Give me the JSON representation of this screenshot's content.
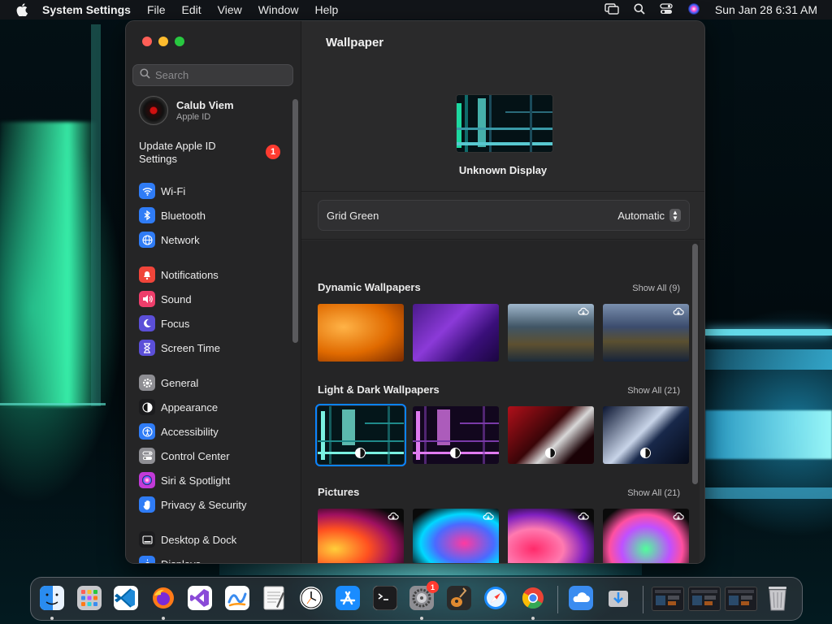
{
  "menubar": {
    "app_name": "System Settings",
    "items": [
      "File",
      "Edit",
      "View",
      "Window",
      "Help"
    ],
    "clock": "Sun Jan 28  6:31 AM"
  },
  "sidebar": {
    "search_placeholder": "Search",
    "account": {
      "name": "Calub Viem",
      "subtitle": "Apple ID"
    },
    "update": {
      "label": "Update Apple ID Settings",
      "badge": "1"
    },
    "groups": [
      [
        {
          "label": "Wi-Fi",
          "icon": "wifi-icon",
          "color": "#2f7cf6"
        },
        {
          "label": "Bluetooth",
          "icon": "bluetooth-icon",
          "color": "#2f7cf6"
        },
        {
          "label": "Network",
          "icon": "globe-icon",
          "color": "#2f7cf6"
        }
      ],
      [
        {
          "label": "Notifications",
          "icon": "bell-icon",
          "color": "#f0453a"
        },
        {
          "label": "Sound",
          "icon": "speaker-icon",
          "color": "#ee3e6b"
        },
        {
          "label": "Focus",
          "icon": "moon-icon",
          "color": "#5b4fd8"
        },
        {
          "label": "Screen Time",
          "icon": "hourglass-icon",
          "color": "#5b4fd8"
        }
      ],
      [
        {
          "label": "General",
          "icon": "gear-icon",
          "color": "#8e8e93"
        },
        {
          "label": "Appearance",
          "icon": "appearance-icon",
          "color": "#1c1c1e"
        },
        {
          "label": "Accessibility",
          "icon": "accessibility-icon",
          "color": "#2f7cf6"
        },
        {
          "label": "Control Center",
          "icon": "control-center-icon",
          "color": "#8e8e93"
        },
        {
          "label": "Siri & Spotlight",
          "icon": "siri-icon",
          "color": "#c23ad8"
        },
        {
          "label": "Privacy & Security",
          "icon": "hand-icon",
          "color": "#2f7cf6"
        }
      ],
      [
        {
          "label": "Desktop & Dock",
          "icon": "dock-icon",
          "color": "#1c1c1e"
        },
        {
          "label": "Displays",
          "icon": "sun-icon",
          "color": "#2f7cf6"
        }
      ]
    ]
  },
  "main": {
    "title": "Wallpaper",
    "display_name": "Unknown Display",
    "current_wallpaper": "Grid Green",
    "mode": "Automatic",
    "sections": [
      {
        "title": "Dynamic Wallpapers",
        "show_all": "Show All (9)",
        "thumbs": [
          {
            "style": "w-ventura",
            "cloud": false,
            "half": false
          },
          {
            "style": "w-monterey",
            "cloud": false,
            "half": false
          },
          {
            "style": "w-catalina-day",
            "cloud": true,
            "half": false
          },
          {
            "style": "w-catalina-dusk",
            "cloud": true,
            "half": false
          }
        ]
      },
      {
        "title": "Light & Dark Wallpapers",
        "show_all": "Show All (21)",
        "thumbs": [
          {
            "style": "w-grid-green",
            "cloud": false,
            "half": true,
            "selected": true
          },
          {
            "style": "w-grid-purple",
            "cloud": false,
            "half": true
          },
          {
            "style": "w-red-wave",
            "cloud": false,
            "half": true
          },
          {
            "style": "w-blue-wave",
            "cloud": false,
            "half": true
          }
        ]
      },
      {
        "title": "Pictures",
        "show_all": "Show All (21)",
        "thumbs": [
          {
            "style": "w-pic1",
            "cloud": true,
            "half": false
          },
          {
            "style": "w-pic2",
            "cloud": true,
            "half": false
          },
          {
            "style": "w-pic3",
            "cloud": true,
            "half": false
          },
          {
            "style": "w-pic4",
            "cloud": true,
            "half": false
          }
        ]
      }
    ]
  },
  "dock": {
    "apps": [
      {
        "name": "finder-icon",
        "color": "#2a8cf0",
        "running": true
      },
      {
        "name": "launchpad-icon",
        "color": "#d8d8dc",
        "running": false
      },
      {
        "name": "vscode-icon",
        "color": "#ffffff",
        "running": false
      },
      {
        "name": "firefox-icon",
        "color": "#ff7a18",
        "running": true
      },
      {
        "name": "visual-studio-icon",
        "color": "#8a4ad8",
        "running": false
      },
      {
        "name": "freeform-icon",
        "color": "#ffffff",
        "running": false
      },
      {
        "name": "textedit-icon",
        "color": "#f4f4f4",
        "running": false
      },
      {
        "name": "clock-icon",
        "color": "#ffffff",
        "running": false
      },
      {
        "name": "app-store-icon",
        "color": "#1a8cff",
        "running": false
      },
      {
        "name": "terminal-icon",
        "color": "#1c1c1e",
        "running": false
      },
      {
        "name": "system-settings-icon",
        "color": "#8e8e93",
        "running": true,
        "badge": "1"
      },
      {
        "name": "garageband-icon",
        "color": "#2a2a2a",
        "running": false
      },
      {
        "name": "safari-icon",
        "color": "#1a8cff",
        "running": false
      },
      {
        "name": "chrome-icon",
        "color": "#ffffff",
        "running": true
      }
    ],
    "extras": [
      {
        "name": "icloud-icon",
        "color": "#3a8cf0"
      },
      {
        "name": "downloads-icon",
        "color": "#c8c8cc"
      }
    ],
    "windows": [
      {
        "name": "minimized-window-1"
      },
      {
        "name": "minimized-window-2"
      },
      {
        "name": "minimized-window-3"
      }
    ],
    "trash": {
      "name": "trash-icon"
    }
  }
}
